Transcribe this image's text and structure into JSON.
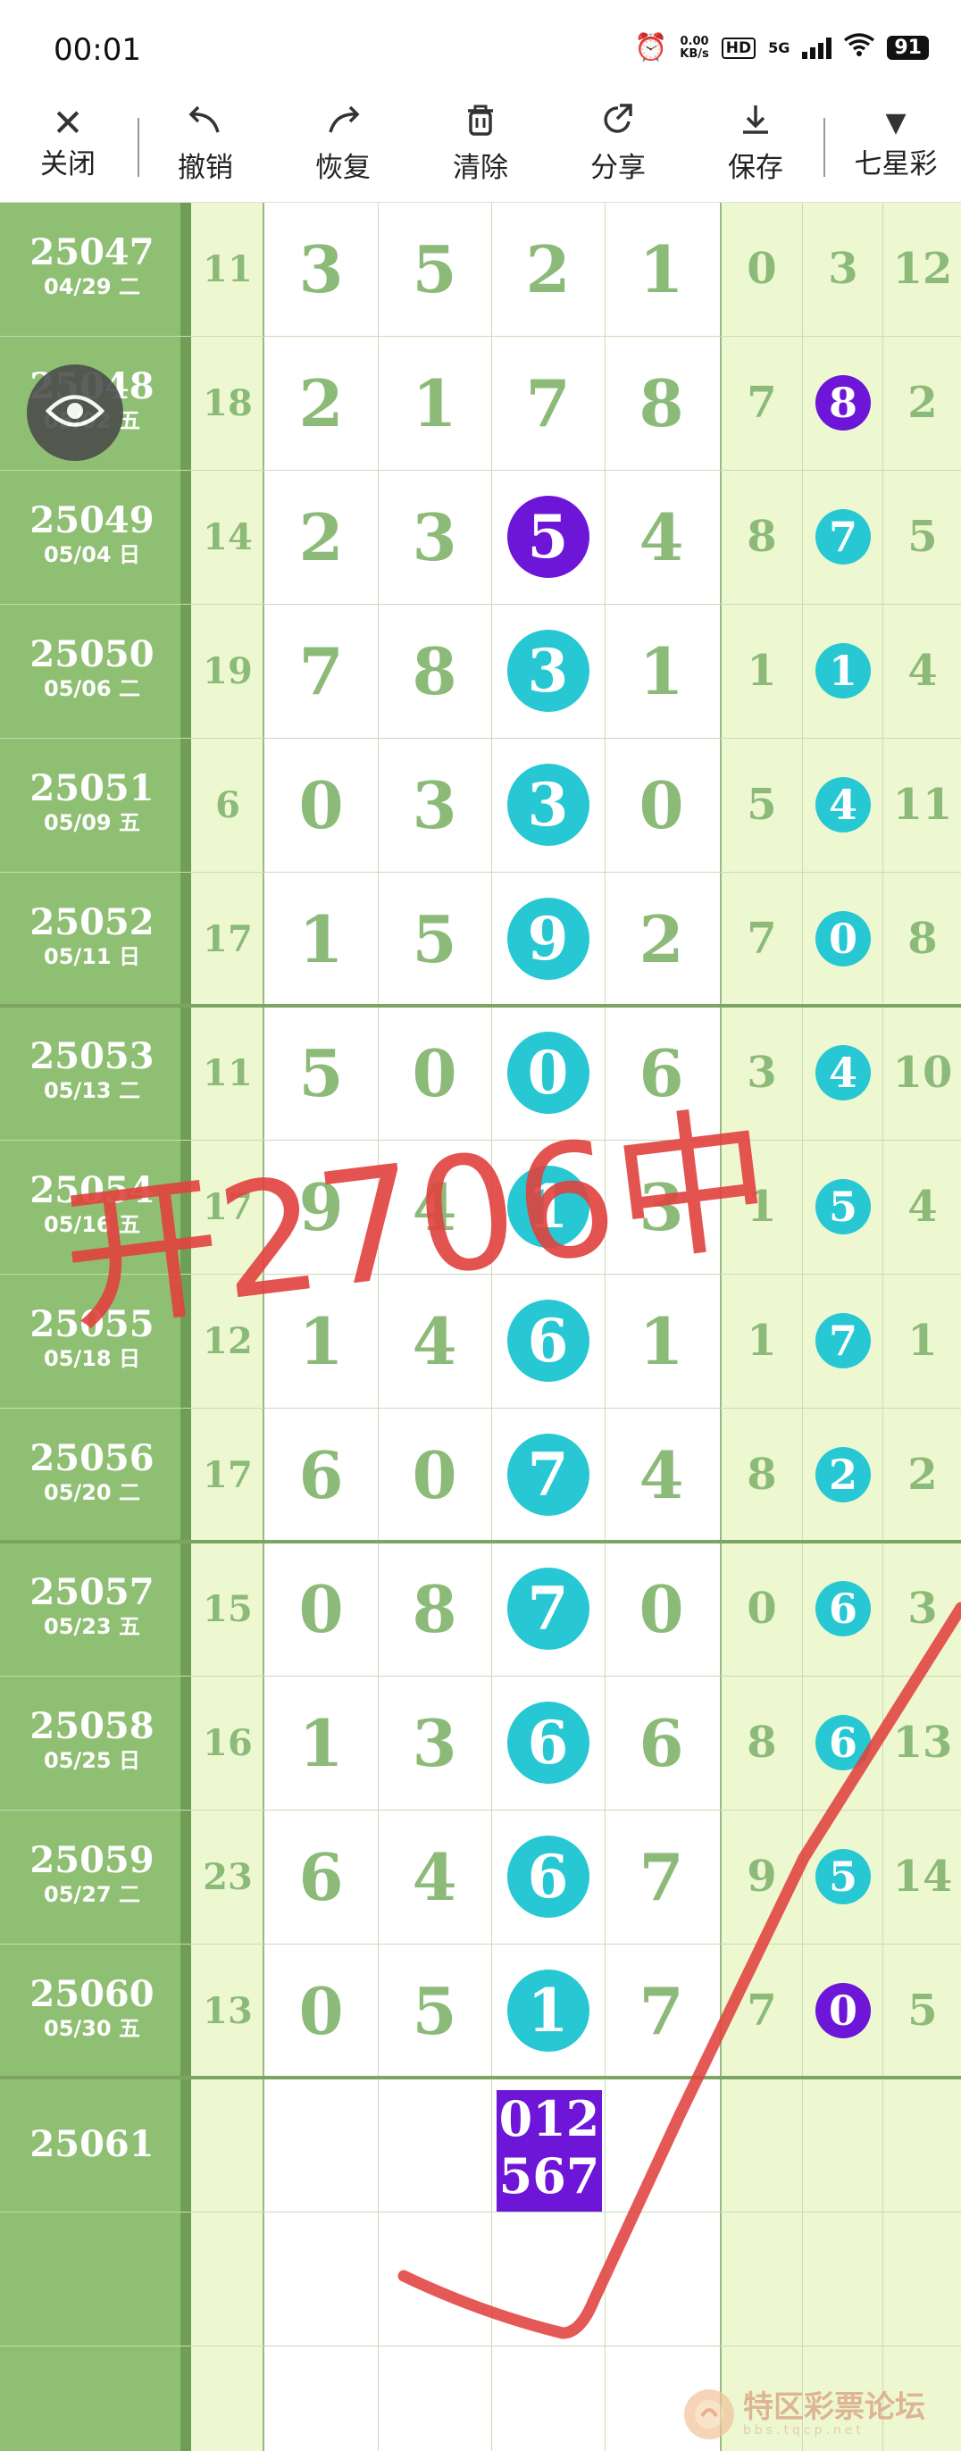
{
  "status_bar": {
    "time": "00:01",
    "net_speed_value": "0.00",
    "net_speed_unit": "KB/s",
    "hd": "HD",
    "network": "5G",
    "battery": "91"
  },
  "toolbar": {
    "close": "关闭",
    "undo": "撤销",
    "redo": "恢复",
    "clear": "清除",
    "share": "分享",
    "save": "保存",
    "lottery": "七星彩"
  },
  "rows": [
    {
      "period": "25047",
      "date": "04/29 二",
      "sum": "11",
      "d": [
        "3",
        "5",
        "2",
        "1"
      ],
      "r": [
        "0",
        "3",
        "12"
      ],
      "ball_index": -1,
      "r_ball": false
    },
    {
      "period": "25048",
      "date": "05/02 五",
      "sum": "18",
      "d": [
        "2",
        "1",
        "7",
        "8"
      ],
      "r": [
        "7",
        "8",
        "2"
      ],
      "ball_index": -1,
      "r_ball": true,
      "r_ball_color": "purple"
    },
    {
      "period": "25049",
      "date": "05/04 日",
      "sum": "14",
      "d": [
        "2",
        "3",
        "5",
        "4"
      ],
      "r": [
        "8",
        "7",
        "5"
      ],
      "ball_index": 2,
      "ball_color": "purple",
      "r_ball": true,
      "r_ball_color": "cyan"
    },
    {
      "period": "25050",
      "date": "05/06 二",
      "sum": "19",
      "d": [
        "7",
        "8",
        "3",
        "1"
      ],
      "r": [
        "1",
        "1",
        "4"
      ],
      "ball_index": 2,
      "ball_color": "cyan",
      "r_ball": true,
      "r_ball_color": "cyan"
    },
    {
      "period": "25051",
      "date": "05/09 五",
      "sum": "6",
      "d": [
        "0",
        "3",
        "3",
        "0"
      ],
      "r": [
        "5",
        "4",
        "11"
      ],
      "ball_index": 2,
      "ball_color": "cyan",
      "r_ball": true,
      "r_ball_color": "cyan"
    },
    {
      "period": "25052",
      "date": "05/11 日",
      "sum": "17",
      "d": [
        "1",
        "5",
        "9",
        "2"
      ],
      "r": [
        "7",
        "0",
        "8"
      ],
      "ball_index": 2,
      "ball_color": "cyan",
      "r_ball": true,
      "r_ball_color": "cyan"
    },
    {
      "period": "25053",
      "date": "05/13 二",
      "sum": "11",
      "d": [
        "5",
        "0",
        "0",
        "6"
      ],
      "r": [
        "3",
        "4",
        "10"
      ],
      "ball_index": 2,
      "ball_color": "cyan",
      "r_ball": true,
      "r_ball_color": "cyan"
    },
    {
      "period": "25054",
      "date": "05/16 五",
      "sum": "17",
      "d": [
        "9",
        "4",
        "1",
        "3"
      ],
      "r": [
        "1",
        "5",
        "4"
      ],
      "ball_index": 2,
      "ball_color": "cyan",
      "r_ball": true,
      "r_ball_color": "cyan"
    },
    {
      "period": "25055",
      "date": "05/18 日",
      "sum": "12",
      "d": [
        "1",
        "4",
        "6",
        "1"
      ],
      "r": [
        "1",
        "7",
        "1"
      ],
      "ball_index": 2,
      "ball_color": "cyan",
      "r_ball": true,
      "r_ball_color": "cyan"
    },
    {
      "period": "25056",
      "date": "05/20 二",
      "sum": "17",
      "d": [
        "6",
        "0",
        "7",
        "4"
      ],
      "r": [
        "8",
        "2",
        "2"
      ],
      "ball_index": 2,
      "ball_color": "cyan",
      "r_ball": true,
      "r_ball_color": "cyan"
    },
    {
      "period": "25057",
      "date": "05/23 五",
      "sum": "15",
      "d": [
        "0",
        "8",
        "7",
        "0"
      ],
      "r": [
        "0",
        "6",
        "3"
      ],
      "ball_index": 2,
      "ball_color": "cyan",
      "r_ball": true,
      "r_ball_color": "cyan"
    },
    {
      "period": "25058",
      "date": "05/25 日",
      "sum": "16",
      "d": [
        "1",
        "3",
        "6",
        "6"
      ],
      "r": [
        "8",
        "6",
        "13"
      ],
      "ball_index": 2,
      "ball_color": "cyan",
      "r_ball": true,
      "r_ball_color": "cyan"
    },
    {
      "period": "25059",
      "date": "05/27 二",
      "sum": "23",
      "d": [
        "6",
        "4",
        "6",
        "7"
      ],
      "r": [
        "9",
        "5",
        "14"
      ],
      "ball_index": 2,
      "ball_color": "cyan",
      "r_ball": true,
      "r_ball_color": "cyan"
    },
    {
      "period": "25060",
      "date": "05/30 五",
      "sum": "13",
      "d": [
        "0",
        "5",
        "1",
        "7"
      ],
      "r": [
        "7",
        "0",
        "5"
      ],
      "ball_index": 2,
      "ball_color": "cyan",
      "r_ball": true,
      "r_ball_color": "purple"
    },
    {
      "period": "25061",
      "date": "",
      "sum": "",
      "d": [
        "",
        "",
        "",
        ""
      ],
      "r": [
        "",
        "",
        ""
      ],
      "ball_index": -1,
      "r_ball": false
    }
  ],
  "prediction": {
    "line1": "012",
    "line2": "567"
  },
  "annotation": "开2706中",
  "watermark": {
    "title": "特区彩票论坛",
    "url": "bbs.tqcp.net"
  },
  "colors": {
    "cyan": "#27c8d3",
    "purple": "#6d16d8",
    "digit": "#8cba78",
    "period_bg": "#8fbf73",
    "annotation": "#e0413e"
  }
}
